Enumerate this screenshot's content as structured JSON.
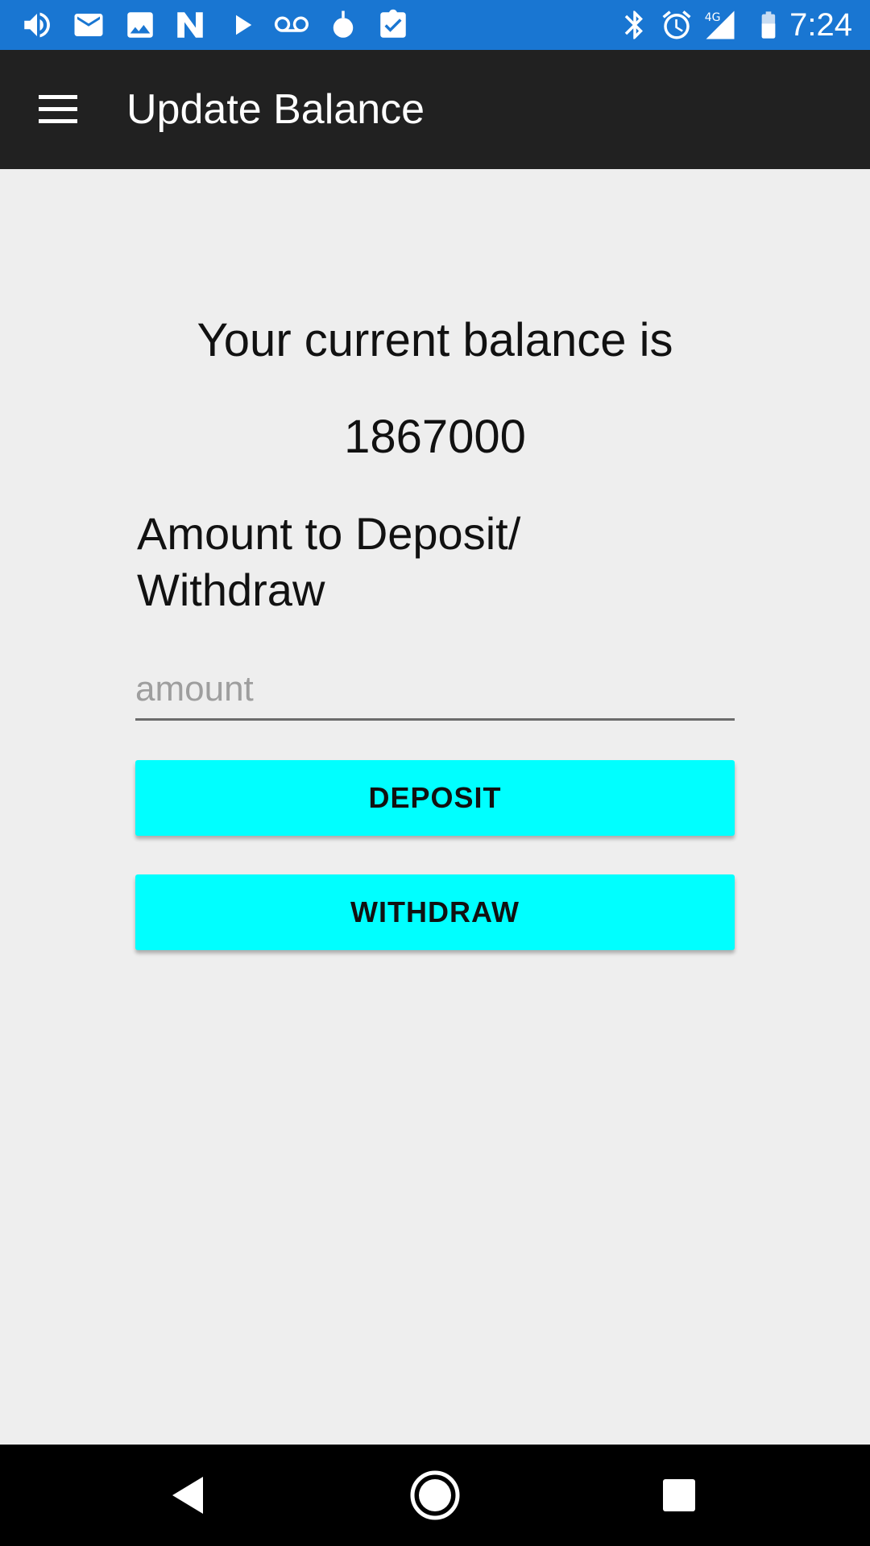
{
  "status_bar": {
    "time": "7:24",
    "color": "#1976d2",
    "left_icons": [
      "volume-icon",
      "mail-icon",
      "image-icon",
      "n-app-icon",
      "play-icon",
      "voicemail-icon",
      "drop-icon",
      "clipboard-check-icon"
    ],
    "right_icons": [
      "bluetooth-icon",
      "alarm-icon",
      "signal-4g-icon",
      "battery-icon"
    ],
    "network_label": "4G"
  },
  "app_bar": {
    "title": "Update Balance",
    "menu_icon": "hamburger-menu-icon",
    "color": "#212121"
  },
  "main": {
    "balance_label": "Your current balance is",
    "balance_value": "1867000",
    "amount_label": "Amount to Deposit/ Withdraw",
    "amount_input": {
      "value": "",
      "placeholder": "amount"
    },
    "deposit_label": "DEPOSIT",
    "withdraw_label": "WITHDRAW",
    "button_color": "#00ffff"
  },
  "nav_bar": {
    "back_icon": "back-triangle-icon",
    "home_icon": "home-circle-icon",
    "recents_icon": "recents-square-icon"
  }
}
